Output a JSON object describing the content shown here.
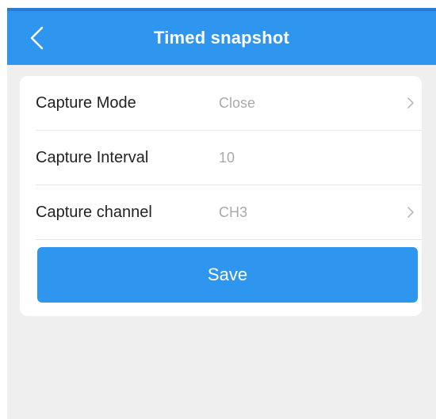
{
  "header": {
    "title": "Timed snapshot",
    "back_icon": "chevron-left-icon",
    "background_color": "#2f96ef"
  },
  "settings": {
    "rows": [
      {
        "label": "Capture Mode",
        "value": "Close",
        "has_chevron": true
      },
      {
        "label": "Capture Interval",
        "value": "10",
        "has_chevron": false
      },
      {
        "label": "Capture channel",
        "value": "CH3",
        "has_chevron": true
      }
    ]
  },
  "actions": {
    "save_label": "Save"
  },
  "colors": {
    "accent": "#2f96ef",
    "page_background": "#efefef",
    "value_text": "#a9a9a9"
  }
}
